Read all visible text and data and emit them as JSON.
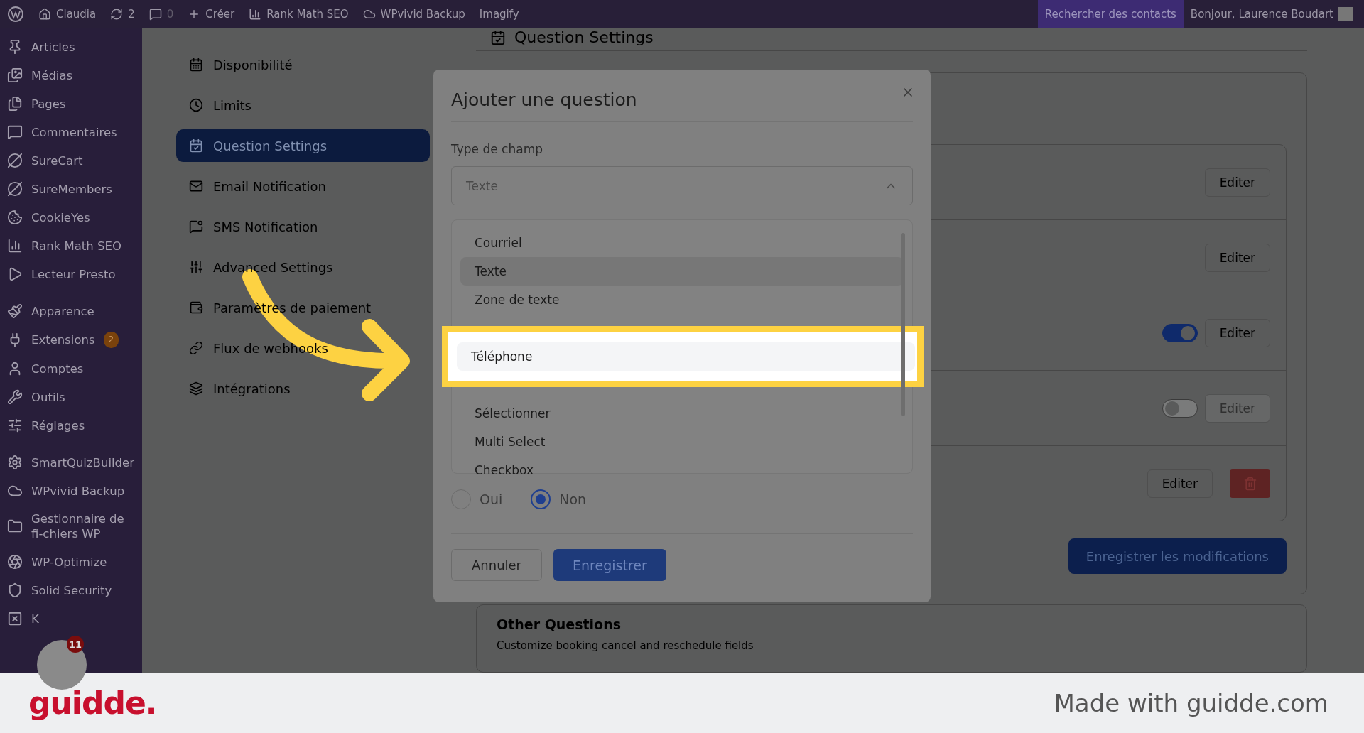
{
  "admin_bar": {
    "site": "Claudia",
    "updates": "2",
    "comments": "0",
    "new": "Créer",
    "plugins": [
      "Rank Math SEO",
      "WPvivid Backup",
      "Imagify"
    ],
    "search_contacts": "Rechercher des contacts",
    "greeting": "Bonjour, Laurence Boudart"
  },
  "sidebar": {
    "groups": [
      [
        {
          "label": "Articles"
        },
        {
          "label": "Médias"
        },
        {
          "label": "Pages"
        },
        {
          "label": "Commentaires"
        },
        {
          "label": "SureCart"
        },
        {
          "label": "SureMembers"
        },
        {
          "label": "CookieYes"
        },
        {
          "label": "Rank Math SEO"
        },
        {
          "label": "Lecteur Presto"
        }
      ],
      [
        {
          "label": "Apparence"
        },
        {
          "label": "Extensions",
          "badge": "2"
        },
        {
          "label": "Comptes"
        },
        {
          "label": "Outils"
        },
        {
          "label": "Réglages"
        }
      ],
      [
        {
          "label": "SmartQuizBuilder"
        },
        {
          "label": "WPvivid Backup"
        },
        {
          "label": "Gestionnaire de fi-chiers WP"
        },
        {
          "label": "WP-Optimize"
        },
        {
          "label": "Solid Security"
        },
        {
          "label": "K"
        }
      ]
    ]
  },
  "settings_nav": {
    "items": [
      {
        "label": "Disponibilité",
        "selected": false
      },
      {
        "label": "Limits",
        "selected": false
      },
      {
        "label": "Question Settings",
        "selected": true
      },
      {
        "label": "Email Notification",
        "selected": false
      },
      {
        "label": "SMS Notification",
        "selected": false
      },
      {
        "label": "Advanced Settings",
        "selected": false
      },
      {
        "label": "Paramètres de paiement",
        "selected": false
      },
      {
        "label": "Flux de webhooks",
        "selected": false
      },
      {
        "label": "Intégrations",
        "selected": false
      }
    ]
  },
  "section": {
    "title": "Question Settings"
  },
  "question_rows": [
    {
      "kind": "edit",
      "edit": "Editer",
      "disabled": false
    },
    {
      "kind": "edit",
      "edit": "Editer",
      "disabled": false
    },
    {
      "kind": "toggle",
      "on": true,
      "edit": "Editer",
      "disabled": false
    },
    {
      "kind": "toggle",
      "on": false,
      "edit": "Editer",
      "disabled": true
    },
    {
      "kind": "delete",
      "edit": "Editer",
      "disabled": false
    }
  ],
  "save_button": "Enregistrer les modifications",
  "other_questions": {
    "title": "Other Questions",
    "description": "Customize booking cancel and reschedule fields"
  },
  "modal": {
    "title": "Ajouter une question",
    "field_label": "Type de champ",
    "select_value": "Texte",
    "expanded": true,
    "options": [
      {
        "label": "Courriel",
        "selected": false,
        "highlighted": false
      },
      {
        "label": "Texte",
        "selected": true,
        "highlighted": false
      },
      {
        "label": "Zone de texte",
        "selected": false,
        "highlighted": false
      },
      {
        "label": "Téléphone",
        "selected": false,
        "highlighted": true
      },
      {
        "label": "Sélectionner",
        "selected": false,
        "highlighted": false
      },
      {
        "label": "Multi Select",
        "selected": false,
        "highlighted": false
      },
      {
        "label": "Checkbox",
        "selected": false,
        "highlighted": false
      }
    ],
    "required_options": [
      {
        "label": "Oui",
        "selected": false
      },
      {
        "label": "Non",
        "selected": true
      }
    ],
    "cancel": "Annuler",
    "submit": "Enregistrer"
  },
  "chat_widget": {
    "badge": "11"
  },
  "footer": {
    "logo": "guidde.",
    "text": "Made with guidde.com"
  }
}
